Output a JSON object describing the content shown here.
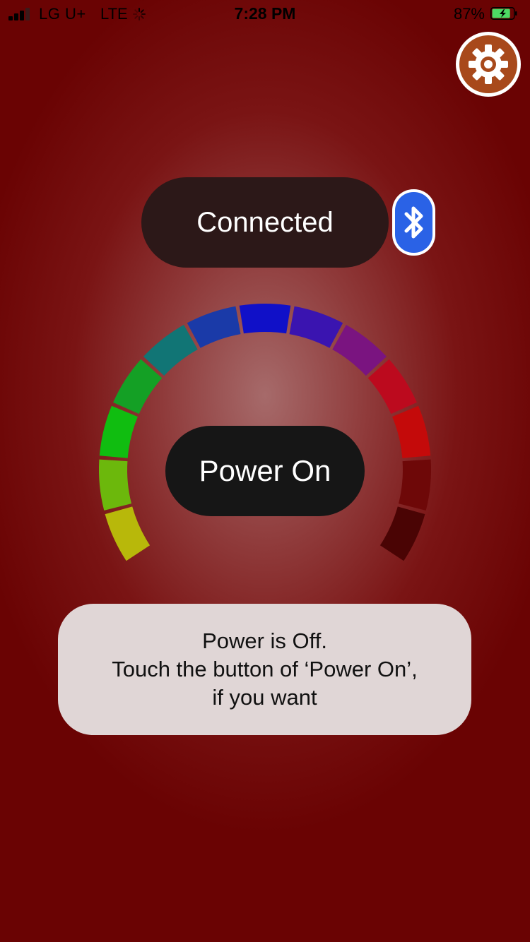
{
  "status_bar": {
    "carrier": "LG U+",
    "network": "LTE",
    "time": "7:28 PM",
    "battery_percent": "87%",
    "battery_level": 0.87,
    "battery_charging": true,
    "signal_bars": 3
  },
  "settings": {
    "icon": "gear-icon",
    "color": "#a8491b"
  },
  "connection": {
    "label": "Connected",
    "icon": "bluetooth-icon",
    "color": "#2a62e6"
  },
  "color_dial": {
    "segments": [
      {
        "name": "yellow-green",
        "color": "#b8b80a"
      },
      {
        "name": "lime",
        "color": "#6cb80c"
      },
      {
        "name": "green",
        "color": "#10bd10"
      },
      {
        "name": "green-2",
        "color": "#14a025"
      },
      {
        "name": "teal",
        "color": "#117575"
      },
      {
        "name": "blue-1",
        "color": "#1a3aa8"
      },
      {
        "name": "blue-2",
        "color": "#1010c8"
      },
      {
        "name": "indigo",
        "color": "#3a14b0"
      },
      {
        "name": "purple",
        "color": "#7a1480"
      },
      {
        "name": "crimson",
        "color": "#bc0a1e"
      },
      {
        "name": "red",
        "color": "#c40a0a"
      },
      {
        "name": "dark-red",
        "color": "#6e0808"
      },
      {
        "name": "deep-red",
        "color": "#4a0404"
      }
    ]
  },
  "power_button": {
    "label": "Power On"
  },
  "message": {
    "lines": [
      "Power is Off.",
      "Touch the button of ‘Power On’,",
      "if you want"
    ]
  }
}
